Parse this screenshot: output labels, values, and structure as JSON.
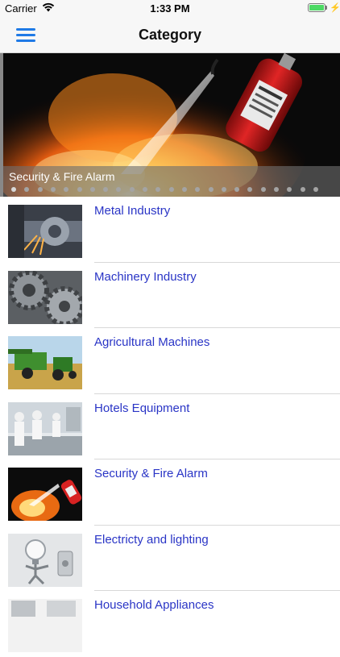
{
  "status_bar": {
    "carrier": "Carrier",
    "time": "1:33 PM"
  },
  "nav": {
    "title": "Category"
  },
  "banner": {
    "caption": "Security & Fire Alarm",
    "page_count": 24,
    "active_index": 0
  },
  "categories": [
    {
      "label": "Metal Industry",
      "icon": "metal-industry-thumbnail"
    },
    {
      "label": "Machinery Industry",
      "icon": "machinery-gears-thumbnail"
    },
    {
      "label": "Agricultural Machines",
      "icon": "combine-harvester-thumbnail"
    },
    {
      "label": "Hotels Equipment",
      "icon": "chefs-kitchen-thumbnail"
    },
    {
      "label": "Security & Fire Alarm",
      "icon": "fire-extinguisher-thumbnail"
    },
    {
      "label": "Electricty and lighting",
      "icon": "lightbulb-figure-thumbnail"
    },
    {
      "label": "Household Appliances",
      "icon": "household-appliances-thumbnail"
    }
  ],
  "colors": {
    "accent": "#1f7ae6",
    "link": "#2a35c6",
    "battery": "#4cd964"
  }
}
